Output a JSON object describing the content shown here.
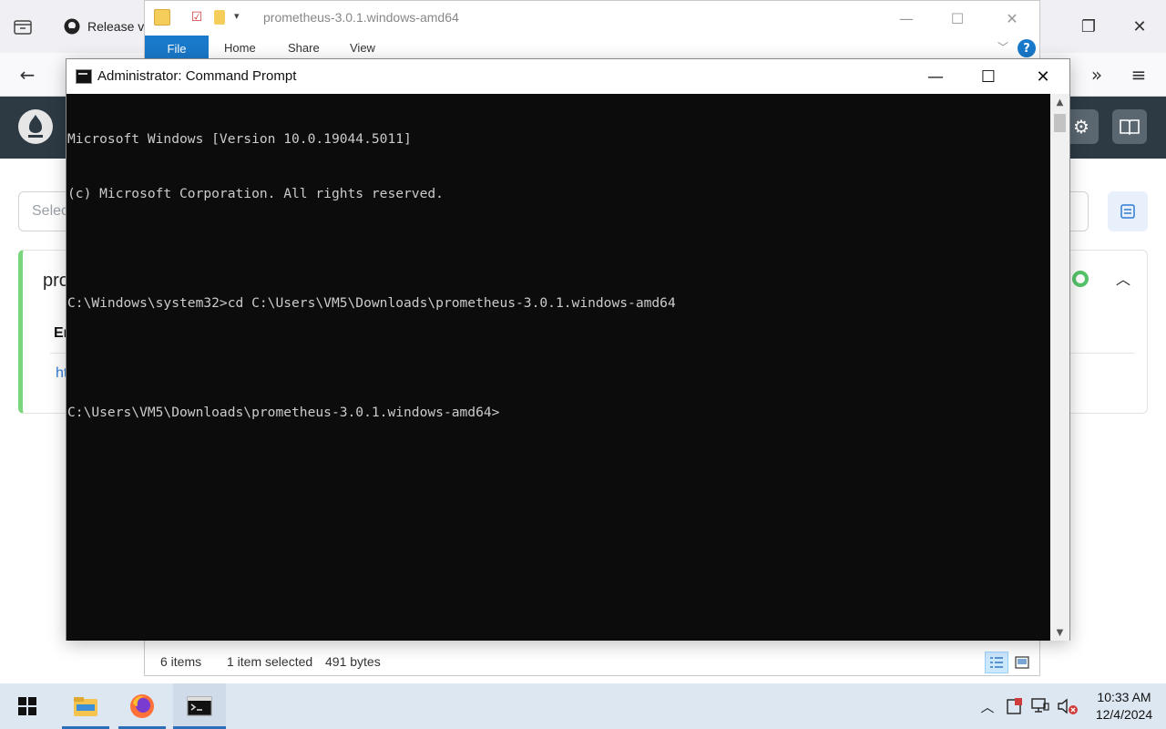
{
  "browser": {
    "tab_title": "Release v",
    "select_placeholder": "Selec",
    "card_title": "pro",
    "card_column_header": "En",
    "card_link_text": "ht"
  },
  "explorer": {
    "title": "prometheus-3.0.1.windows-amd64",
    "ribbon": {
      "file": "File",
      "home": "Home",
      "share": "Share",
      "view": "View",
      "help": "?"
    },
    "status": {
      "items": "6 items",
      "selected": "1 item selected",
      "size": "491 bytes"
    }
  },
  "cmd": {
    "title": "Administrator: Command Prompt",
    "lines": [
      "Microsoft Windows [Version 10.0.19044.5011]",
      "(c) Microsoft Corporation. All rights reserved.",
      "",
      "C:\\Windows\\system32>cd C:\\Users\\VM5\\Downloads\\prometheus-3.0.1.windows-amd64",
      "",
      "C:\\Users\\VM5\\Downloads\\prometheus-3.0.1.windows-amd64>"
    ]
  },
  "taskbar": {
    "time": "10:33 AM",
    "date": "12/4/2024",
    "apps": [
      "file-explorer",
      "firefox",
      "command-prompt"
    ]
  },
  "colors": {
    "console_bg": "#0c0c0c",
    "console_fg": "#cccccc",
    "prometheus_header": "#2d3a44",
    "explorer_accent": "#1979ca",
    "taskbar_bg": "#dde7f2",
    "card_status_border": "#7bd67b"
  }
}
